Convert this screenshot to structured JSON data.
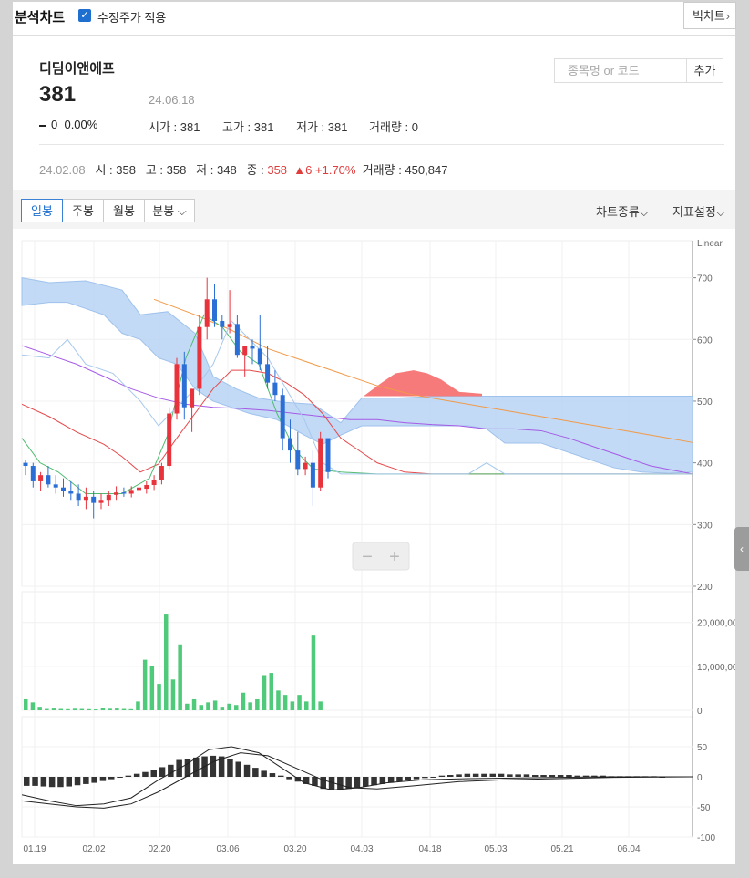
{
  "header": {
    "title": "분석차트",
    "adjusted_label": "수정주가 적용",
    "adjusted_checked": true,
    "big_chart_label": "빅차트"
  },
  "stock": {
    "name": "디딤이앤에프",
    "price": "381",
    "date": "24.06.18",
    "change": "0",
    "change_pct": "0.00%",
    "open_label": "시가",
    "open": "381",
    "high_label": "고가",
    "high": "381",
    "low_label": "저가",
    "low": "381",
    "vol_label": "거래량",
    "volume": "0"
  },
  "search": {
    "placeholder": "종목명 or 코드",
    "add_label": "추가"
  },
  "detail": {
    "date": "24.02.08",
    "open_label": "시",
    "open": "358",
    "high_label": "고",
    "high": "358",
    "low_label": "저",
    "low": "348",
    "close_label": "종",
    "close": "358",
    "change": "▲6",
    "change_pct": "+1.70%",
    "vol_label": "거래량",
    "volume": "450,847"
  },
  "tabs": [
    "일봉",
    "주봉",
    "월봉",
    "분봉"
  ],
  "menus": {
    "chart_type": "차트종류",
    "indicator": "지표설정"
  },
  "zoom": {
    "minus": "−",
    "plus": "+"
  },
  "colors": {
    "up": "#e8323c",
    "down": "#2b6fd6",
    "cloud_blue": "#b7d3f3",
    "cloud_red": "#f77a7a",
    "volume": "#4fc97a"
  },
  "chart_data": {
    "type": "candlestick",
    "scale_label": "Linear",
    "price_axis": {
      "ylim": [
        200,
        760
      ],
      "ticks": [
        700,
        600,
        500,
        400,
        300,
        200
      ]
    },
    "volume_axis": {
      "ylim": [
        0,
        27000000
      ],
      "ticks": [
        "20,000,000",
        "10,000,000",
        "0"
      ],
      "tick_values": [
        20000000,
        10000000,
        0
      ]
    },
    "macd_axis": {
      "ylim": [
        -100,
        100
      ],
      "ticks": [
        50,
        0,
        -50,
        -100
      ]
    },
    "x_ticks": [
      "01.19",
      "02.02",
      "02.20",
      "03.06",
      "03.20",
      "04.03",
      "04.18",
      "05.03",
      "05.21",
      "06.04"
    ],
    "candles_ohlc": [
      [
        400,
        405,
        380,
        395
      ],
      [
        395,
        400,
        360,
        370
      ],
      [
        370,
        385,
        355,
        380
      ],
      [
        380,
        395,
        360,
        365
      ],
      [
        365,
        380,
        350,
        360
      ],
      [
        360,
        375,
        345,
        355
      ],
      [
        355,
        370,
        340,
        350
      ],
      [
        350,
        365,
        330,
        340
      ],
      [
        340,
        360,
        325,
        345
      ],
      [
        345,
        355,
        310,
        335
      ],
      [
        335,
        350,
        325,
        340
      ],
      [
        340,
        355,
        330,
        348
      ],
      [
        348,
        362,
        340,
        352
      ],
      [
        352,
        360,
        345,
        350
      ],
      [
        350,
        362,
        344,
        356
      ],
      [
        356,
        370,
        350,
        360
      ],
      [
        358,
        370,
        350,
        364
      ],
      [
        364,
        380,
        356,
        372
      ],
      [
        372,
        400,
        365,
        395
      ],
      [
        395,
        490,
        390,
        480
      ],
      [
        480,
        570,
        470,
        560
      ],
      [
        560,
        580,
        470,
        490
      ],
      [
        490,
        520,
        450,
        520
      ],
      [
        520,
        640,
        510,
        620
      ],
      [
        620,
        700,
        600,
        665
      ],
      [
        665,
        690,
        620,
        630
      ],
      [
        630,
        640,
        600,
        620
      ],
      [
        620,
        680,
        610,
        625
      ],
      [
        625,
        640,
        570,
        575
      ],
      [
        575,
        590,
        540,
        590
      ],
      [
        590,
        600,
        560,
        585
      ],
      [
        585,
        640,
        550,
        560
      ],
      [
        560,
        590,
        520,
        530
      ],
      [
        530,
        550,
        500,
        510
      ],
      [
        510,
        520,
        420,
        440
      ],
      [
        440,
        470,
        400,
        420
      ],
      [
        420,
        450,
        380,
        390
      ],
      [
        390,
        410,
        380,
        400
      ],
      [
        400,
        420,
        330,
        360
      ],
      [
        360,
        450,
        355,
        440
      ],
      [
        440,
        410,
        375,
        385
      ]
    ],
    "volume_values": [
      2500000,
      1800000,
      800000,
      300000,
      400000,
      300000,
      250000,
      350000,
      300000,
      250000,
      200000,
      450000,
      350000,
      400000,
      300000,
      250000,
      2000000,
      11500000,
      10000000,
      6000000,
      22000000,
      7000000,
      15000000,
      1500000,
      2500000,
      1200000,
      1800000,
      2200000,
      800000,
      1500000,
      1200000,
      4000000,
      1800000,
      2500000,
      8000000,
      8500000,
      4500000,
      3500000,
      2000000,
      3500000,
      2000000,
      17000000,
      2000000
    ],
    "volume_up": [
      true,
      false,
      true,
      false,
      true,
      false,
      true,
      false,
      true,
      false,
      true,
      true,
      true,
      false,
      true,
      true,
      true,
      true,
      false,
      true,
      true,
      false,
      true,
      true,
      true,
      false,
      true,
      true,
      false,
      true,
      false,
      true,
      false,
      true,
      false,
      true,
      false,
      true,
      true,
      true,
      false,
      true,
      false
    ],
    "macd_hist": [
      -15,
      -15,
      -16,
      -17,
      -17,
      -16,
      -14,
      -12,
      -10,
      -7,
      -4,
      -1,
      2,
      5,
      8,
      12,
      16,
      20,
      28,
      30,
      32,
      34,
      35,
      34,
      30,
      25,
      20,
      15,
      10,
      6,
      2,
      -4,
      -8,
      -12,
      -15,
      -20,
      -22,
      -22,
      -20,
      -18,
      -16,
      -14,
      -12,
      -10,
      -8,
      -6,
      -4,
      -2,
      0,
      2,
      3,
      4,
      5,
      5,
      5,
      5,
      5,
      4,
      4,
      4,
      3,
      3,
      3,
      3,
      3,
      2,
      2,
      2,
      2,
      1,
      1,
      1,
      1,
      1,
      1,
      0
    ]
  }
}
